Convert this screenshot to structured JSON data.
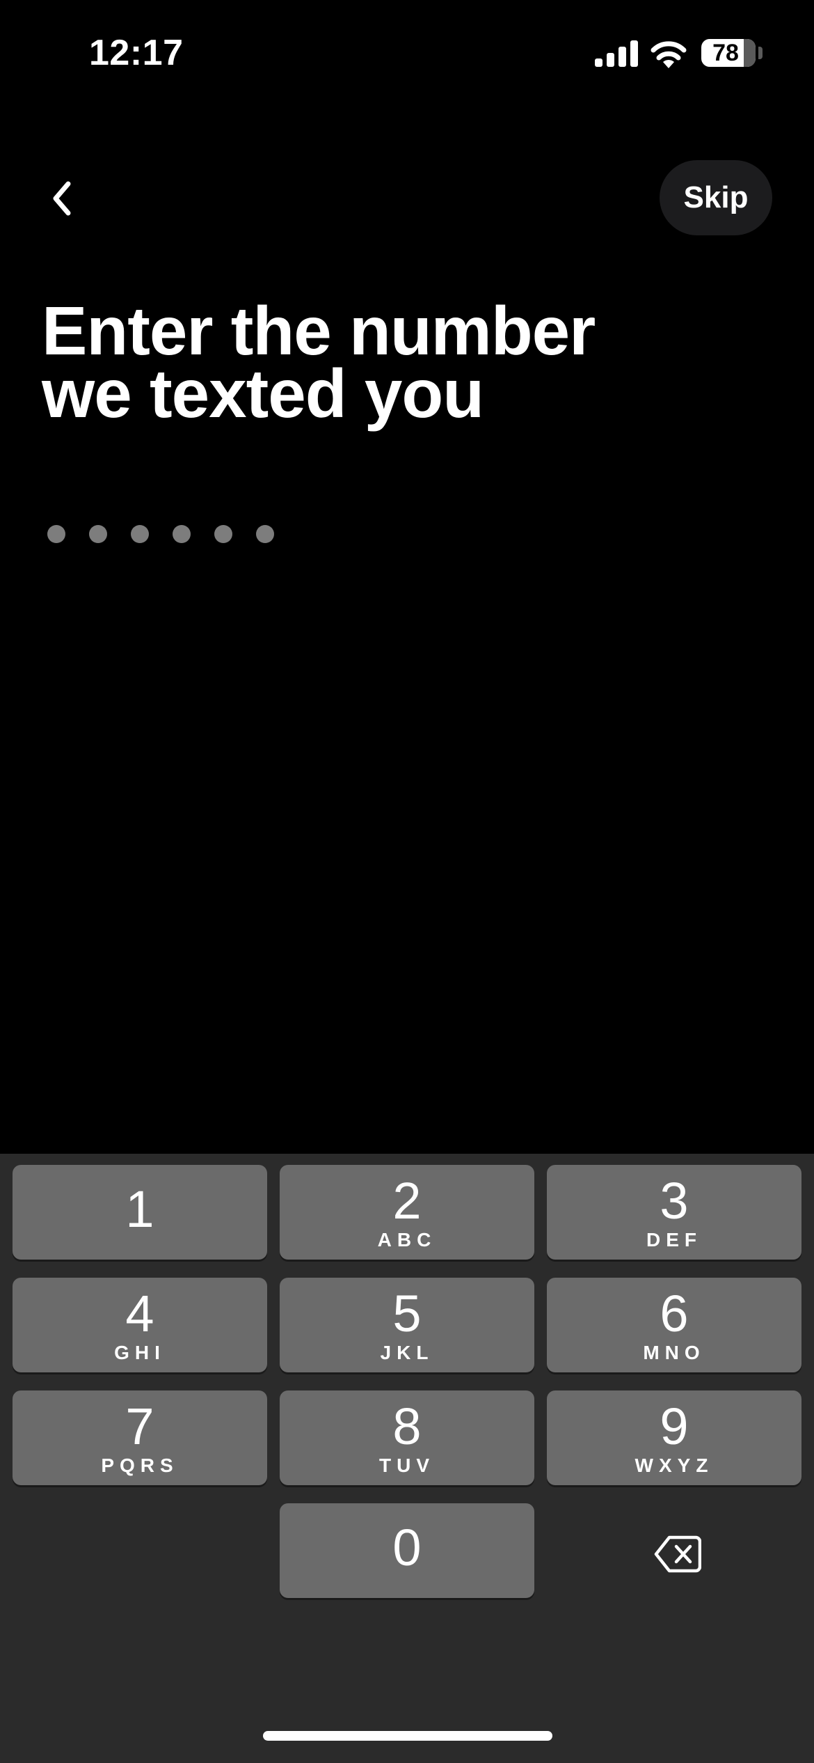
{
  "status_bar": {
    "time": "12:17",
    "battery_level": "78",
    "signal_icon": "cellular-signal-icon",
    "wifi_icon": "wifi-icon"
  },
  "header": {
    "back_icon": "chevron-left-icon",
    "skip_label": "Skip"
  },
  "title": {
    "line1": "Enter the number",
    "line2": "we texted you"
  },
  "code_entry": {
    "length": 6,
    "entered": ""
  },
  "keypad": {
    "keys": [
      {
        "digit": "1",
        "letters": ""
      },
      {
        "digit": "2",
        "letters": "ABC"
      },
      {
        "digit": "3",
        "letters": "DEF"
      },
      {
        "digit": "4",
        "letters": "GHI"
      },
      {
        "digit": "5",
        "letters": "JKL"
      },
      {
        "digit": "6",
        "letters": "MNO"
      },
      {
        "digit": "7",
        "letters": "PQRS"
      },
      {
        "digit": "8",
        "letters": "TUV"
      },
      {
        "digit": "9",
        "letters": "WXYZ"
      },
      {
        "digit": "0",
        "letters": ""
      }
    ],
    "delete_icon": "backspace-icon"
  },
  "colors": {
    "background": "#000000",
    "keypad_background": "#2b2b2b",
    "key_background": "#6b6b6b",
    "skip_button_background": "#1c1c1e",
    "dot_color": "#7d7d7d"
  }
}
